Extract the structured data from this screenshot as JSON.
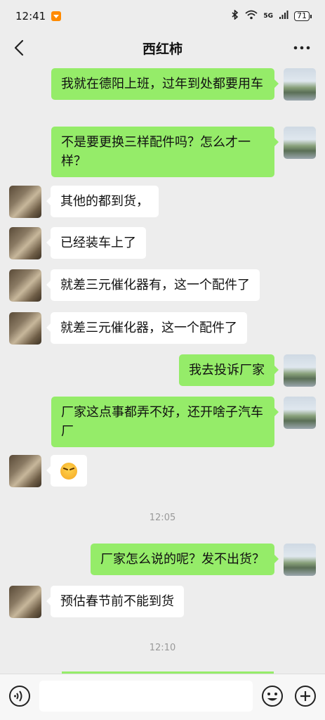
{
  "status_bar": {
    "time": "12:41",
    "network": "5G",
    "battery": "71"
  },
  "header": {
    "title": "西红柿",
    "more": "···"
  },
  "messages": [
    {
      "side": "out",
      "text": "我就在德阳上班，过年到处都要用车"
    },
    {
      "side": "out",
      "text": "不是要更换三样配件吗？怎么才一样？"
    },
    {
      "side": "in",
      "text": "其他的都到货，"
    },
    {
      "side": "in",
      "text": "已经装车上了"
    },
    {
      "side": "in",
      "text": "就差三元催化器有，这一个配件了"
    },
    {
      "side": "in",
      "text": "就差三元催化器，这一个配件了"
    },
    {
      "side": "out",
      "text": "我去投诉厂家"
    },
    {
      "side": "out",
      "text": "厂家这点事都弄不好，还开啥子汽车厂"
    },
    {
      "side": "in",
      "emoji": "angry-face"
    },
    {
      "time": "12:05"
    },
    {
      "side": "out",
      "text": "厂家怎么说的呢？发不出货？"
    },
    {
      "side": "in",
      "text": "预估春节前不能到货"
    },
    {
      "time": "12:10"
    }
  ],
  "input": {
    "placeholder": ""
  }
}
